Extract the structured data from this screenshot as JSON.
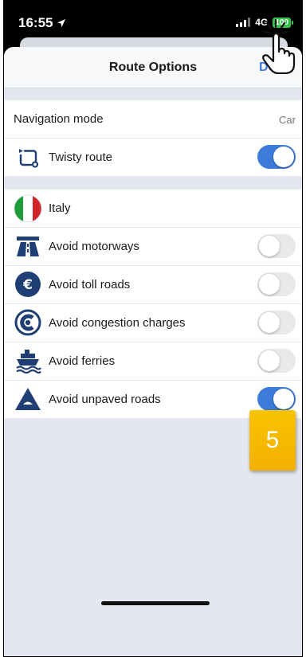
{
  "status_bar": {
    "time": "16:55",
    "network": "4G",
    "battery": "100"
  },
  "nav": {
    "title": "Route Options",
    "done_label": "Done"
  },
  "navigation": {
    "mode_label": "Navigation mode",
    "mode_value": "Car",
    "twisty_label": "Twisty route",
    "twisty_enabled": true
  },
  "region": {
    "country": "Italy",
    "avoid_options": [
      {
        "label": "Avoid motorways",
        "icon": "motorway-icon",
        "enabled": false
      },
      {
        "label": "Avoid toll roads",
        "icon": "euro-toll-icon",
        "enabled": false
      },
      {
        "label": "Avoid congestion charges",
        "icon": "congestion-charge-icon",
        "enabled": false
      },
      {
        "label": "Avoid ferries",
        "icon": "ferry-icon",
        "enabled": false
      },
      {
        "label": "Avoid unpaved roads",
        "icon": "unpaved-road-icon",
        "enabled": true
      }
    ]
  },
  "step_badge": "5",
  "colors": {
    "accent": "#3c7bd9",
    "icon_navy": "#1f3f74",
    "badge": "#f5b800",
    "italy_green": "#1f9d3a",
    "italy_red": "#d1252c"
  }
}
